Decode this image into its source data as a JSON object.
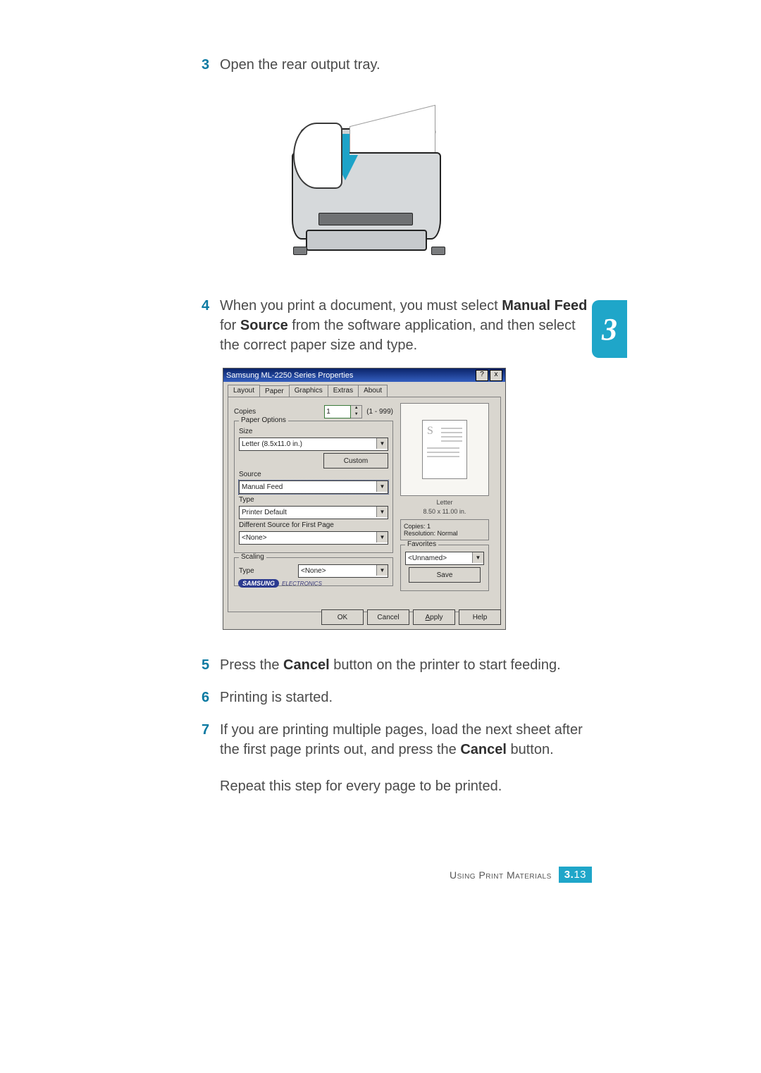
{
  "steps": {
    "s3": {
      "num": "3",
      "text": "Open the rear output tray."
    },
    "s4": {
      "num": "4",
      "pre": "When you print a document, you must select ",
      "b1": "Manual Feed",
      "mid": " for ",
      "b2": "Source",
      "post": " from the software application, and then select the correct paper size and type."
    },
    "s5": {
      "num": "5",
      "pre": "Press the ",
      "b": "Cancel",
      "post": " button on the printer to start feeding."
    },
    "s6": {
      "num": "6",
      "text": "Printing is started."
    },
    "s7": {
      "num": "7",
      "pre": "If you are printing multiple pages, load the next sheet after the first page prints out, and press the ",
      "b": "Cancel",
      "post": " button."
    },
    "s7b": {
      "text": "Repeat this step for every page to be printed."
    }
  },
  "dialog": {
    "title": "Samsung ML-2250 Series Properties",
    "help": "?",
    "close": "x",
    "tabs": {
      "layout": "Layout",
      "paper": "Paper",
      "graphics": "Graphics",
      "extras": "Extras",
      "about": "About"
    },
    "copies": {
      "label": "Copies",
      "value": "1",
      "range": "(1 - 999)"
    },
    "paper_options": {
      "title": "Paper Options",
      "size_label": "Size",
      "size_value": "Letter (8.5x11.0 in.)",
      "custom": "Custom",
      "source_label": "Source",
      "source_value": "Manual Feed",
      "type_label": "Type",
      "type_value": "Printer Default",
      "diff_label": "Different Source for First Page",
      "diff_value": "<None>"
    },
    "scaling": {
      "title": "Scaling",
      "type_label": "Type",
      "type_value": "<None>"
    },
    "preview": {
      "paper": "Letter",
      "dims": "8.50 x 11.00 in."
    },
    "info": {
      "copies": "Copies: 1",
      "res": "Resolution: Normal"
    },
    "favorites": {
      "title": "Favorites",
      "value": "<Unnamed>",
      "save": "Save"
    },
    "brand": {
      "logo": "SAMSUNG",
      "sub": "ELECTRONICS"
    },
    "buttons": {
      "ok": "OK",
      "cancel": "Cancel",
      "apply": "Apply",
      "help": "Help"
    }
  },
  "side_tab": "3",
  "footer": {
    "section": "Using Print Materials",
    "chap": "3.",
    "page": "13"
  }
}
